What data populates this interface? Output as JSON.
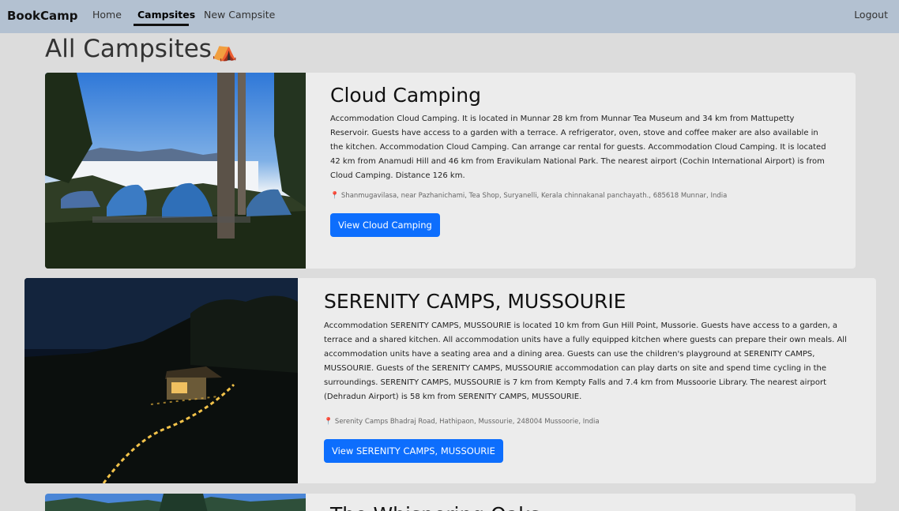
{
  "nav": {
    "brand": "BookCamp",
    "links": [
      {
        "label": "Home"
      },
      {
        "label": "Campsites",
        "active": true
      },
      {
        "label": "New Campsite"
      }
    ],
    "logout": "Logout"
  },
  "page": {
    "title": "All Campsites",
    "title_emoji": "⛺"
  },
  "campsites": [
    {
      "title": "Cloud Camping",
      "description": "Accommodation Cloud Camping. It is located in Munnar 28 km from Munnar Tea Museum and 34 km from Mattupetty Reservoir. Guests have access to a garden with a terrace. A refrigerator, oven, stove and coffee maker are also available in the kitchen. Accommodation Cloud Camping. Can arrange car rental for guests. Accommodation Cloud Camping. It is located 42 km from Anamudi Hill and 46 km from Eravikulam National Park. The nearest airport (Cochin International Airport) is from Cloud Camping. Distance 126 km.",
      "location": "Shanmugavilasa, near Pazhanichami, Tea Shop, Suryanelli, Kerala chinnakanal panchayath., 685618 Munnar, India",
      "button": "View Cloud Camping"
    },
    {
      "title": "SERENITY CAMPS, MUSSOURIE",
      "description": "Accommodation SERENITY CAMPS, MUSSOURIE is located 10 km from Gun Hill Point, Mussorie. Guests have access to a garden, a terrace and a shared kitchen. All accommodation units have a fully equipped kitchen where guests can prepare their own meals. All accommodation units have a seating area and a dining area. Guests can use the children's playground at SERENITY CAMPS, MUSSOURIE. Guests of the SERENITY CAMPS, MUSSOURIE accommodation can play darts on site and spend time cycling in the surroundings. SERENITY CAMPS, MUSSOURIE is 7 km from Kempty Falls and 7.4 km from Mussoorie Library. The nearest airport (Dehradun Airport) is 58 km from SERENITY CAMPS, MUSSOURIE.",
      "location": "Serenity Camps Bhadraj Road, Hathipaon, Mussourie, 248004 Mussoorie, India",
      "button": "View SERENITY CAMPS, MUSSOURIE"
    },
    {
      "title": "The Whispering Oaks"
    }
  ],
  "icons": {
    "location": "map-pin-icon",
    "tent": "tent-emoji"
  },
  "colors": {
    "navbar": "#b3c1d1",
    "primary_button": "#0d6efd",
    "page_bg": "#dcdcdc",
    "card_bg": "#ececec"
  }
}
